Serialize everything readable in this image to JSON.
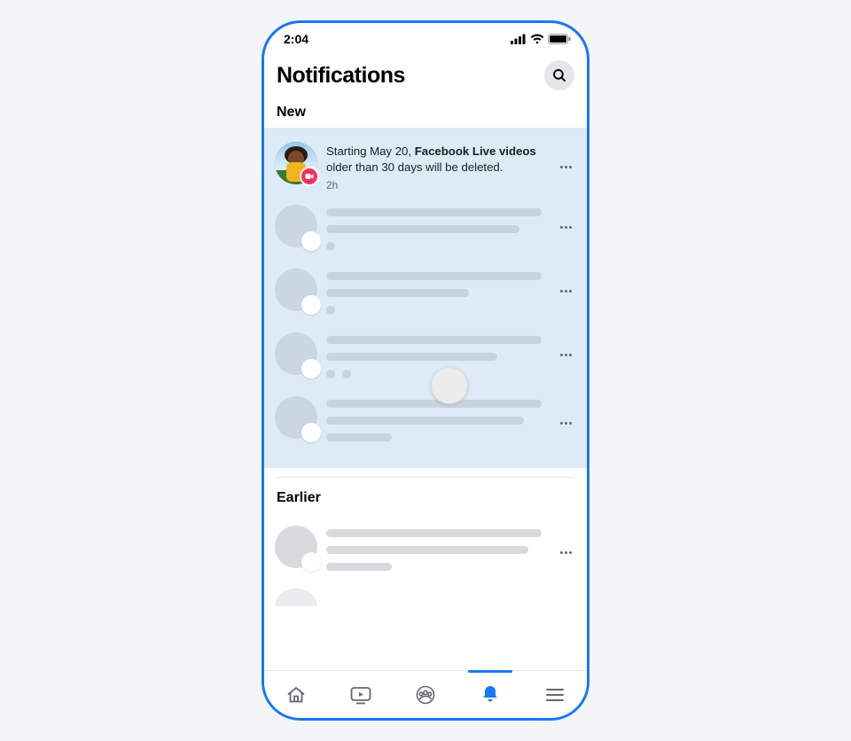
{
  "status": {
    "time": "2:04"
  },
  "header": {
    "title": "Notifications"
  },
  "sections": {
    "new_label": "New",
    "earlier_label": "Earlier"
  },
  "notification": {
    "text_prefix": "Starting May 20, ",
    "text_bold": "Facebook Live videos",
    "text_suffix": " older than 30 days will be deleted.",
    "time": "2h"
  },
  "tabs": {
    "home": "home",
    "watch": "watch",
    "groups": "groups",
    "notifications": "notifications",
    "menu": "menu",
    "active": "notifications"
  },
  "colors": {
    "accent": "#1877f2",
    "new_bg": "#dcebf7",
    "live_badge": "#f92f60"
  }
}
